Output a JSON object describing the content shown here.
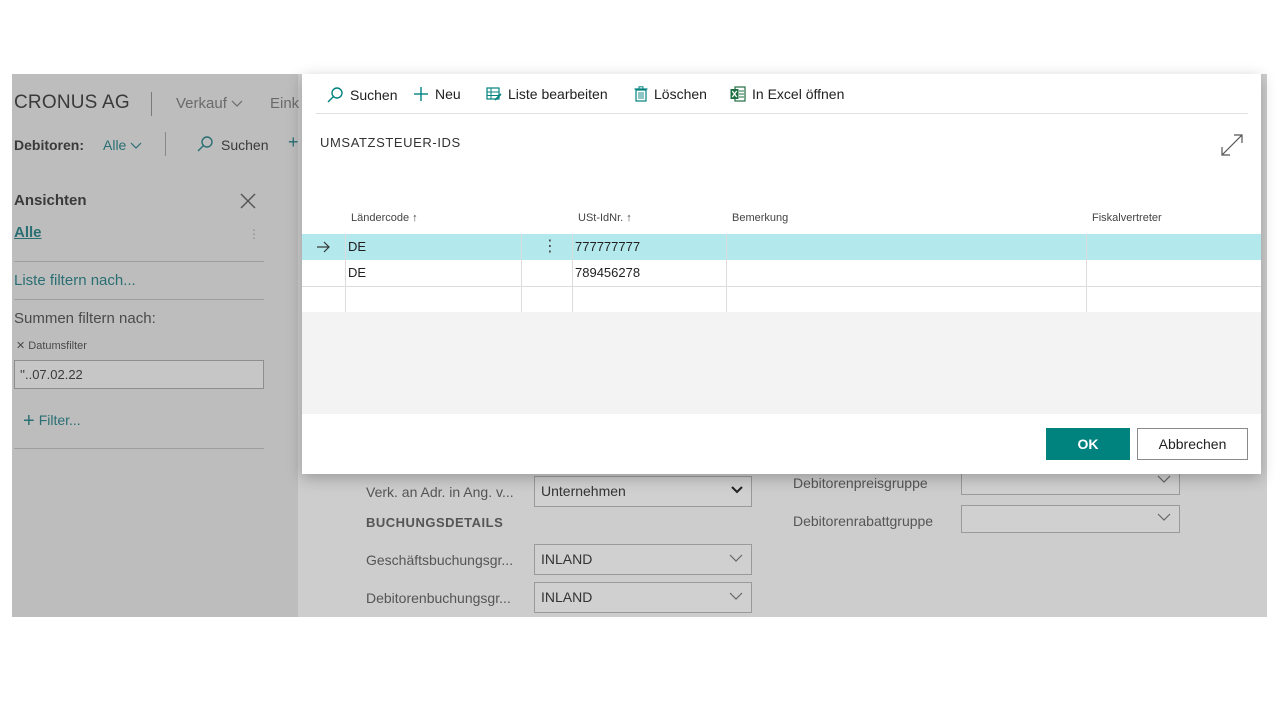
{
  "background": {
    "company": "CRONUS AG",
    "nav": {
      "verkauf": "Verkauf",
      "eink": "Eink"
    },
    "customers_label": "Debitoren:",
    "customers_filter": "Alle",
    "search_label": "Suchen",
    "views": {
      "title": "Ansichten",
      "selected": "Alle",
      "filter_list": "Liste filtern nach...",
      "sum_filter": "Summen filtern nach:",
      "date_filter_label": "Datumsfilter",
      "date_filter_value": "''..07.02.22",
      "add_filter": "Filter..."
    },
    "fields": {
      "verk_label": "Verk. an Adr. in Ang. v...",
      "verk_value": "Unternehmen",
      "section_booking": "BUCHUNGSDETAILS",
      "gesch_label": "Geschäftsbuchungsgr...",
      "gesch_value": "INLAND",
      "deb_label": "Debitorenbuchungsgr...",
      "deb_value": "INLAND",
      "preis_label": "Debitorenpreisgruppe",
      "rabatt_label": "Debitorenrabattgruppe"
    }
  },
  "dialog": {
    "toolbar": {
      "search": "Suchen",
      "new": "Neu",
      "edit_list": "Liste bearbeiten",
      "delete": "Löschen",
      "excel": "In Excel öffnen"
    },
    "title": "UMSATZSTEUER-IDS",
    "columns": {
      "country": "Ländercode",
      "vat": "USt-IdNr.",
      "remark": "Bemerkung",
      "fiscal": "Fiskalvertreter"
    },
    "rows": [
      {
        "country": "DE",
        "vat": "777777777",
        "remark": "",
        "fiscal": ""
      },
      {
        "country": "DE",
        "vat": "789456278",
        "remark": "",
        "fiscal": ""
      }
    ],
    "ok_label": "OK",
    "cancel_label": "Abbrechen"
  },
  "colors": {
    "accent": "#00827f",
    "selected_row": "#b3e8ec",
    "link": "#2a6f73"
  }
}
